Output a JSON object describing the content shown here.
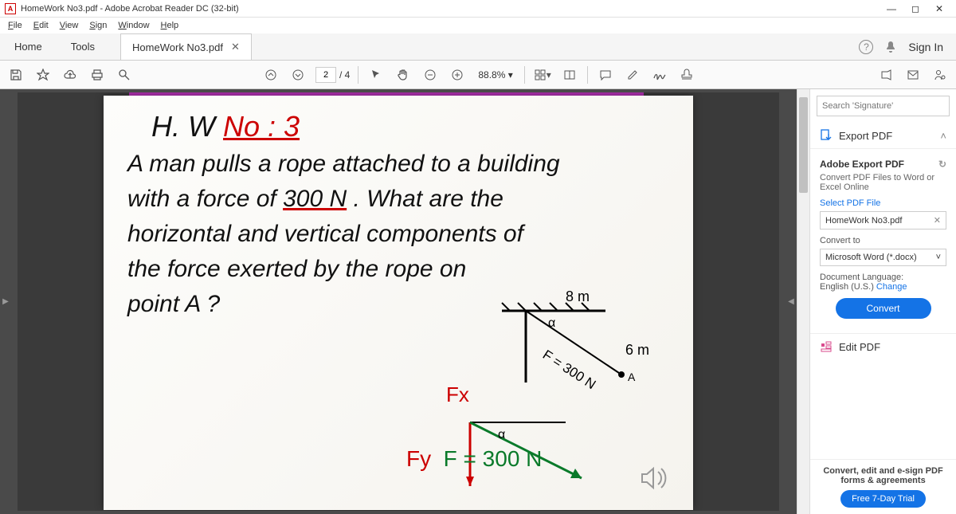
{
  "titlebar": {
    "title": "HomeWork No3.pdf - Adobe Acrobat Reader DC (32-bit)"
  },
  "menubar": {
    "file": "File",
    "edit": "Edit",
    "view": "View",
    "sign": "Sign",
    "window": "Window",
    "help": "Help"
  },
  "tabbar": {
    "home": "Home",
    "tools": "Tools",
    "doc": "HomeWork No3.pdf",
    "signin": "Sign In"
  },
  "toolbar": {
    "page_current": "2",
    "page_total": "/ 4",
    "zoom": "88.8%"
  },
  "document": {
    "hw_prefix": "H. W   ",
    "hw_no": "No : 3",
    "line1": "A man pulls a rope attached to a building",
    "line2a": "with a force of ",
    "line2_force": "300 N",
    "line2b": " . What are the",
    "line3": "horizontal and vertical components of",
    "line4": "the force exerted by the rope on",
    "line5": "point A ?",
    "dim_top": "8 m",
    "dim_side": "6 m",
    "alpha": "α",
    "f_eq": "F = 300 N",
    "fx": "Fx",
    "fy": "Fy",
    "f_eq2": "F = 300 N"
  },
  "sidepanel": {
    "search_placeholder": "Search 'Signature'",
    "export_pdf": "Export PDF",
    "adobe_export": "Adobe Export PDF",
    "convert_desc": "Convert PDF Files to Word or Excel Online",
    "select_label": "Select PDF File",
    "selected_file": "HomeWork No3.pdf",
    "convert_to": "Convert to",
    "convert_format": "Microsoft Word (*.docx)",
    "doc_lang_label": "Document Language:",
    "doc_lang_value": "English (U.S.)",
    "change": "Change",
    "convert_btn": "Convert",
    "edit_pdf": "Edit PDF",
    "promo_text": "Convert, edit and e-sign PDF forms & agreements",
    "trial_btn": "Free 7-Day Trial"
  }
}
